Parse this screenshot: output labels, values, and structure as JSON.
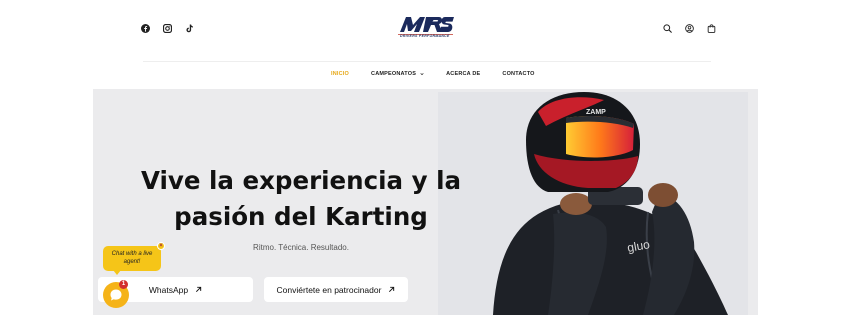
{
  "header": {
    "logo_text": "MRS",
    "logo_subtitle": "DRIVERS PERFORMANCE",
    "social_icons": [
      "facebook-icon",
      "instagram-icon",
      "tiktok-icon"
    ],
    "tool_icons": [
      "search-icon",
      "user-icon",
      "cart-icon"
    ]
  },
  "nav": {
    "items": [
      {
        "label": "INICIO",
        "active": true
      },
      {
        "label": "CAMPEONATOS",
        "has_dropdown": true
      },
      {
        "label": "ACERCA DE"
      },
      {
        "label": "CONTACTO"
      }
    ]
  },
  "hero": {
    "headline_line1": "Vive la experiencia y la",
    "headline_line2": "pasión del Karting",
    "tagline": "Ritmo. Técnica. Resultado.",
    "button_whatsapp": "WhatsApp",
    "button_sponsor": "Conviértete en patrocinador",
    "image_description": "karting driver in helmet",
    "helmet_text": "ZAMP",
    "suit_text": "gluo"
  },
  "chat": {
    "bubble_text": "Chat with a live agent!",
    "badge_count": "1",
    "close_symbol": "×"
  },
  "colors": {
    "accent": "#e6a817",
    "chat_yellow": "#f5c518",
    "hero_bg": "#ebebed",
    "brand_navy": "#1b2a5c"
  }
}
